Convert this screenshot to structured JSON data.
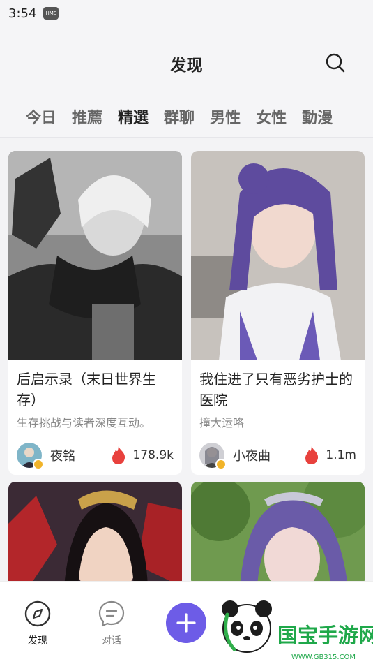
{
  "status": {
    "time": "3:54",
    "badge": "HMS"
  },
  "header": {
    "title": "发现"
  },
  "tabs": [
    "今日",
    "推薦",
    "精選",
    "群聊",
    "男性",
    "女性",
    "動漫"
  ],
  "active_tab": "精選",
  "cards": [
    {
      "title": "后启示录（末日世界生存）",
      "desc": "生存挑战与读者深度互动。",
      "author": "夜铭",
      "count": "178.9k"
    },
    {
      "title": "我住进了只有恶劣护士的医院",
      "desc": "撞大运咯",
      "author": "小夜曲",
      "count": "1.1m"
    }
  ],
  "tabbar": {
    "discover": "发现",
    "chat": "对话"
  },
  "watermark": {
    "brand": "国宝手游网",
    "url": "WWW.GB315.COM"
  },
  "colors": {
    "accent": "#6d5ce7",
    "fire": "#e8413d",
    "verified": "#f1b42a"
  }
}
